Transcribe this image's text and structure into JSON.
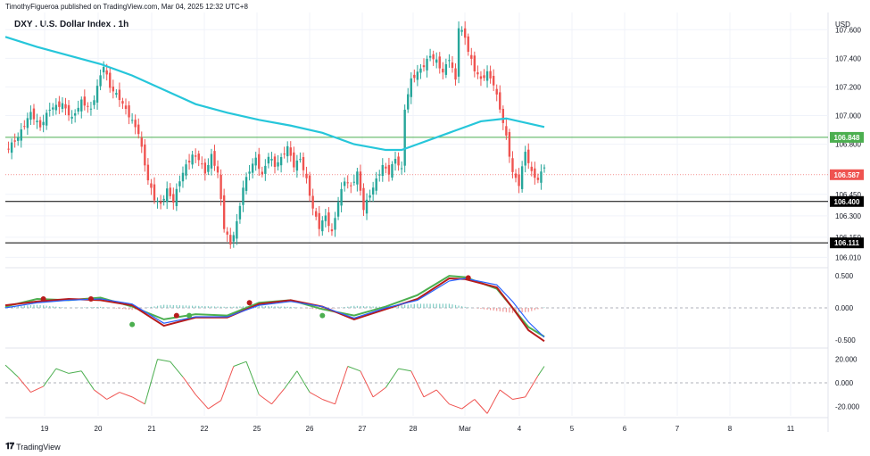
{
  "header": {
    "published": "TimothyFigueroa published on TradingView.com, Mar 04, 2025 12:32 UTC+8",
    "title": "DXY . U.S. Dollar Index . 1h"
  },
  "footer": {
    "brand": "TradingView",
    "logo_icon": "tradingview-logo-icon"
  },
  "colors": {
    "up": "#26a69a",
    "down": "#ef5350",
    "ma": "#26c6da",
    "green_line": "#4caf50",
    "black_line": "#000000",
    "price_tag": "#ef5350"
  },
  "chart_data": [
    {
      "type": "candlestick",
      "title": "DXY . U.S. Dollar Index . 1h",
      "currency": "USD",
      "x_ticks": [
        "19",
        "20",
        "21",
        "22",
        "25",
        "26",
        "27",
        "28",
        "Mar",
        "4",
        "5",
        "6",
        "7",
        "8",
        "11"
      ],
      "y_ticks": [
        "107.600",
        "107.400",
        "107.200",
        "107.000",
        "106.800",
        "106.450",
        "106.300",
        "106.150",
        "106.010"
      ],
      "ylim": [
        105.95,
        107.72
      ],
      "horizontal_levels": [
        {
          "label": "106.848",
          "value": 106.848,
          "color": "#4caf50",
          "style": "solid"
        },
        {
          "label": "106.400",
          "value": 106.4,
          "color": "#000000",
          "style": "solid"
        },
        {
          "label": "106.111",
          "value": 106.111,
          "color": "#000000",
          "style": "solid"
        }
      ],
      "last_price": {
        "label": "106.587",
        "value": 106.587
      },
      "close_path": [
        [
          0,
          106.75
        ],
        [
          4,
          106.85
        ],
        [
          8,
          107.02
        ],
        [
          11,
          106.92
        ],
        [
          14,
          107.05
        ],
        [
          18,
          107.08
        ],
        [
          21,
          106.98
        ],
        [
          24,
          107.1
        ],
        [
          27,
          107.04
        ],
        [
          30,
          107.28
        ],
        [
          31,
          107.35
        ],
        [
          33,
          107.2
        ],
        [
          36,
          107.12
        ],
        [
          39,
          107.0
        ],
        [
          42,
          106.88
        ],
        [
          45,
          106.55
        ],
        [
          47,
          106.42
        ],
        [
          49,
          106.38
        ],
        [
          51,
          106.48
        ],
        [
          53,
          106.4
        ],
        [
          55,
          106.55
        ],
        [
          57,
          106.65
        ],
        [
          59,
          106.72
        ],
        [
          61,
          106.7
        ],
        [
          63,
          106.6
        ],
        [
          65,
          106.72
        ],
        [
          67,
          106.6
        ],
        [
          69,
          106.22
        ],
        [
          71,
          106.1
        ],
        [
          73,
          106.25
        ],
        [
          75,
          106.5
        ],
        [
          77,
          106.62
        ],
        [
          79,
          106.7
        ],
        [
          81,
          106.58
        ],
        [
          83,
          106.72
        ],
        [
          85,
          106.65
        ],
        [
          87,
          106.7
        ],
        [
          89,
          106.78
        ],
        [
          91,
          106.65
        ],
        [
          93,
          106.7
        ],
        [
          95,
          106.55
        ],
        [
          97,
          106.35
        ],
        [
          99,
          106.22
        ],
        [
          101,
          106.3
        ],
        [
          103,
          106.18
        ],
        [
          105,
          106.4
        ],
        [
          107,
          106.55
        ],
        [
          109,
          106.5
        ],
        [
          111,
          106.6
        ],
        [
          113,
          106.35
        ],
        [
          115,
          106.45
        ],
        [
          117,
          106.55
        ],
        [
          119,
          106.65
        ],
        [
          121,
          106.6
        ],
        [
          123,
          106.7
        ],
        [
          125,
          106.62
        ],
        [
          126,
          107.05
        ],
        [
          128,
          107.25
        ],
        [
          130,
          107.3
        ],
        [
          132,
          107.35
        ],
        [
          134,
          107.42
        ],
        [
          136,
          107.38
        ],
        [
          138,
          107.3
        ],
        [
          140,
          107.4
        ],
        [
          142,
          107.25
        ],
        [
          143,
          107.62
        ],
        [
          145,
          107.55
        ],
        [
          146,
          107.45
        ],
        [
          148,
          107.32
        ],
        [
          150,
          107.25
        ],
        [
          152,
          107.3
        ],
        [
          154,
          107.22
        ],
        [
          156,
          107.05
        ],
        [
          158,
          106.85
        ],
        [
          160,
          106.6
        ],
        [
          162,
          106.52
        ],
        [
          164,
          106.75
        ],
        [
          166,
          106.6
        ],
        [
          168,
          106.55
        ],
        [
          170,
          106.65
        ]
      ],
      "series": [
        {
          "name": "",
          "type": "moving_average",
          "color": "#26c6da",
          "points": [
            [
              0,
              107.55
            ],
            [
              10,
              107.48
            ],
            [
              20,
              107.42
            ],
            [
              30,
              107.36
            ],
            [
              40,
              107.28
            ],
            [
              50,
              107.18
            ],
            [
              60,
              107.08
            ],
            [
              70,
              107.02
            ],
            [
              80,
              106.97
            ],
            [
              90,
              106.93
            ],
            [
              100,
              106.88
            ],
            [
              110,
              106.8
            ],
            [
              120,
              106.76
            ],
            [
              125,
              106.76
            ],
            [
              130,
              106.8
            ],
            [
              140,
              106.88
            ],
            [
              150,
              106.96
            ],
            [
              158,
              106.98
            ],
            [
              170,
              106.92
            ]
          ]
        }
      ]
    },
    {
      "type": "line",
      "title": "",
      "y_ticks": [
        "0.500",
        "0.000",
        "-0.500"
      ],
      "ylim": [
        -0.6,
        0.6
      ],
      "series": [
        {
          "name": "",
          "color": "#4caf50",
          "points": [
            [
              0,
              0.02
            ],
            [
              10,
              0.14
            ],
            [
              20,
              0.12
            ],
            [
              30,
              0.16
            ],
            [
              40,
              0.02
            ],
            [
              50,
              -0.18
            ],
            [
              60,
              -0.1
            ],
            [
              70,
              -0.12
            ],
            [
              80,
              0.08
            ],
            [
              90,
              0.12
            ],
            [
              100,
              -0.02
            ],
            [
              110,
              -0.12
            ],
            [
              120,
              0.02
            ],
            [
              130,
              0.2
            ],
            [
              140,
              0.5
            ],
            [
              145,
              0.48
            ],
            [
              155,
              0.3
            ],
            [
              160,
              0.0
            ],
            [
              165,
              -0.3
            ],
            [
              170,
              -0.45
            ]
          ]
        },
        {
          "name": "",
          "color": "#b71c1c",
          "points": [
            [
              0,
              0.04
            ],
            [
              10,
              0.1
            ],
            [
              20,
              0.14
            ],
            [
              30,
              0.12
            ],
            [
              40,
              0.04
            ],
            [
              50,
              -0.28
            ],
            [
              60,
              -0.15
            ],
            [
              70,
              -0.15
            ],
            [
              80,
              0.06
            ],
            [
              90,
              0.12
            ],
            [
              100,
              0.02
            ],
            [
              110,
              -0.18
            ],
            [
              120,
              -0.02
            ],
            [
              130,
              0.14
            ],
            [
              140,
              0.46
            ],
            [
              145,
              0.45
            ],
            [
              155,
              0.32
            ],
            [
              160,
              0.0
            ],
            [
              165,
              -0.35
            ],
            [
              170,
              -0.52
            ]
          ]
        },
        {
          "name": "",
          "color": "#2962ff",
          "points": [
            [
              0,
              0.0
            ],
            [
              10,
              0.08
            ],
            [
              20,
              0.12
            ],
            [
              30,
              0.14
            ],
            [
              40,
              0.06
            ],
            [
              50,
              -0.24
            ],
            [
              60,
              -0.14
            ],
            [
              70,
              -0.14
            ],
            [
              80,
              0.04
            ],
            [
              90,
              0.1
            ],
            [
              100,
              0.02
            ],
            [
              110,
              -0.16
            ],
            [
              120,
              0.0
            ],
            [
              130,
              0.12
            ],
            [
              140,
              0.42
            ],
            [
              145,
              0.46
            ],
            [
              155,
              0.36
            ],
            [
              160,
              0.1
            ],
            [
              165,
              -0.22
            ],
            [
              170,
              -0.46
            ]
          ]
        }
      ],
      "markers": [
        {
          "x": 12,
          "y": 0.14,
          "color": "#b71c1c"
        },
        {
          "x": 27,
          "y": 0.14,
          "color": "#b71c1c"
        },
        {
          "x": 40,
          "y": -0.26,
          "color": "#4caf50"
        },
        {
          "x": 54,
          "y": -0.12,
          "color": "#b71c1c"
        },
        {
          "x": 58,
          "y": -0.12,
          "color": "#4caf50"
        },
        {
          "x": 77,
          "y": 0.08,
          "color": "#b71c1c"
        },
        {
          "x": 100,
          "y": -0.12,
          "color": "#4caf50"
        },
        {
          "x": 146,
          "y": 0.47,
          "color": "#b71c1c"
        }
      ]
    },
    {
      "type": "line",
      "title": "",
      "y_ticks": [
        "20.000",
        "0.000",
        "-20.000"
      ],
      "ylim": [
        -28,
        28
      ],
      "series": [
        {
          "name": "",
          "color": "#4caf50",
          "points": [
            [
              0,
              15
            ],
            [
              4,
              5
            ],
            [
              8,
              -8
            ],
            [
              12,
              -3
            ],
            [
              16,
              12
            ],
            [
              20,
              8
            ],
            [
              24,
              10
            ],
            [
              28,
              -6
            ],
            [
              32,
              -14
            ],
            [
              36,
              -8
            ],
            [
              40,
              -12
            ],
            [
              44,
              -18
            ],
            [
              48,
              20
            ],
            [
              52,
              18
            ],
            [
              56,
              5
            ],
            [
              60,
              -10
            ],
            [
              64,
              -22
            ],
            [
              68,
              -15
            ],
            [
              72,
              14
            ],
            [
              76,
              18
            ],
            [
              80,
              -10
            ],
            [
              84,
              -18
            ],
            [
              88,
              -5
            ],
            [
              92,
              10
            ],
            [
              96,
              -8
            ],
            [
              100,
              -14
            ],
            [
              104,
              -18
            ],
            [
              108,
              14
            ],
            [
              112,
              10
            ],
            [
              116,
              -12
            ],
            [
              120,
              -4
            ],
            [
              124,
              12
            ],
            [
              128,
              10
            ],
            [
              132,
              -12
            ],
            [
              136,
              -6
            ],
            [
              140,
              -18
            ],
            [
              144,
              -22
            ],
            [
              148,
              -14
            ],
            [
              152,
              -26
            ],
            [
              156,
              -6
            ],
            [
              160,
              -14
            ],
            [
              164,
              -12
            ],
            [
              168,
              6
            ],
            [
              170,
              14
            ]
          ]
        }
      ]
    }
  ]
}
